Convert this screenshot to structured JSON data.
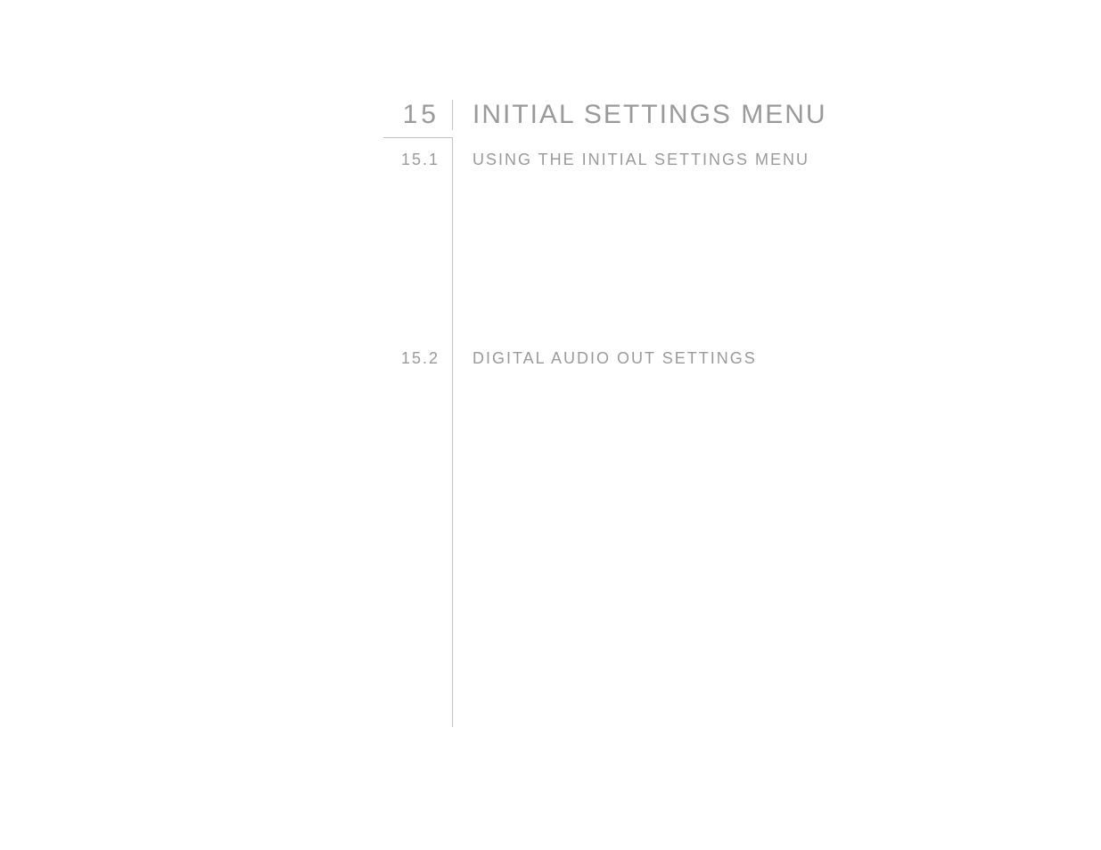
{
  "chapter": {
    "number": "15",
    "title": "INITIAL SETTINGS MENU"
  },
  "sections": [
    {
      "number": "15.1",
      "title": "USING THE INITIAL SETTINGS MENU"
    },
    {
      "number": "15.2",
      "title": "DIGITAL AUDIO OUT SETTINGS"
    }
  ]
}
